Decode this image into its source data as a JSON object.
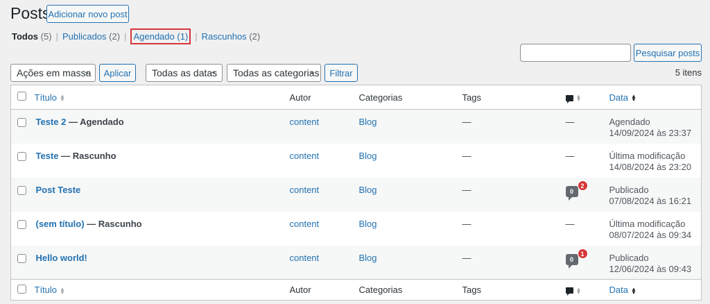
{
  "header": {
    "title": "Posts",
    "add_new": "Adicionar novo post"
  },
  "filters": [
    {
      "label": "Todos",
      "count": "(5)"
    },
    {
      "label": "Publicados",
      "count": "(2)"
    },
    {
      "label": "Agendado",
      "count": "(1)"
    },
    {
      "label": "Rascunhos",
      "count": "(2)"
    }
  ],
  "search": {
    "value": "",
    "button": "Pesquisar posts"
  },
  "toolbar": {
    "bulk": "Ações em massa",
    "apply": "Aplicar",
    "dates": "Todas as datas",
    "categories": "Todas as categorias",
    "filter": "Filtrar",
    "count": "5 itens"
  },
  "columns": {
    "title": "Título",
    "author": "Autor",
    "categories": "Categorias",
    "tags": "Tags",
    "date": "Data"
  },
  "rows": [
    {
      "title": "Teste 2",
      "state": " — Agendado",
      "author": "content",
      "category": "Blog",
      "tags": "—",
      "comments": "—",
      "status": "Agendado",
      "date": "14/09/2024 às 23:37"
    },
    {
      "title": "Teste",
      "state": " — Rascunho",
      "author": "content",
      "category": "Blog",
      "tags": "—",
      "comments": "—",
      "status": "Última modificação",
      "date": "14/08/2024 às 23:20"
    },
    {
      "title": "Post Teste",
      "state": "",
      "author": "content",
      "category": "Blog",
      "tags": "—",
      "approved": "0",
      "pending": "2",
      "status": "Publicado",
      "date": "07/08/2024 às 16:21"
    },
    {
      "title": "(sem título)",
      "state": " — Rascunho",
      "author": "content",
      "category": "Blog",
      "tags": "—",
      "comments": "—",
      "status": "Última modificação",
      "date": "08/07/2024 às 09:34"
    },
    {
      "title": "Hello world!",
      "state": "",
      "author": "content",
      "category": "Blog",
      "tags": "—",
      "approved": "0",
      "pending": "1",
      "status": "Publicado",
      "date": "12/06/2024 às 09:43"
    }
  ]
}
